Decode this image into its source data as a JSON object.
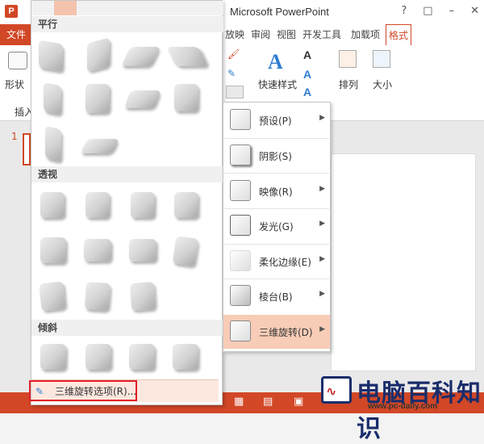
{
  "window": {
    "title": "Microsoft PowerPoint",
    "help": "?",
    "minimize": "–",
    "restore": "□",
    "close": "✕",
    "app_logo": "P"
  },
  "tabs": {
    "file": "文件",
    "animation": "放映",
    "review": "审阅",
    "view": "视图",
    "developer": "开发工具",
    "addins": "加载项",
    "format": "格式"
  },
  "ribbon": {
    "shape_label": "形状",
    "insert_label": "插入",
    "quick_styles": "快速样式",
    "arrange": "排列",
    "size": "大小"
  },
  "slide": {
    "number": "1"
  },
  "gallery": {
    "section_parallel": "平行",
    "section_perspective": "透视",
    "section_oblique": "倾斜",
    "options_label": "三维旋转选项(R)..."
  },
  "effects_menu": {
    "items": [
      {
        "label": "预设(P)",
        "has_arrow": true
      },
      {
        "label": "阴影(S)",
        "has_arrow": true
      },
      {
        "label": "映像(R)",
        "has_arrow": true
      },
      {
        "label": "发光(G)",
        "has_arrow": true
      },
      {
        "label": "柔化边缘(E)",
        "has_arrow": true
      },
      {
        "label": "棱台(B)",
        "has_arrow": true
      },
      {
        "label": "三维旋转(D)",
        "has_arrow": true
      }
    ],
    "arrow_glyph": "▶"
  },
  "watermark": {
    "text": "电脑百科知识",
    "url": "www.pc-daily.com"
  },
  "colors": {
    "accent": "#d24726",
    "highlight": "#f8ccb7",
    "footer": "#fde8df"
  }
}
